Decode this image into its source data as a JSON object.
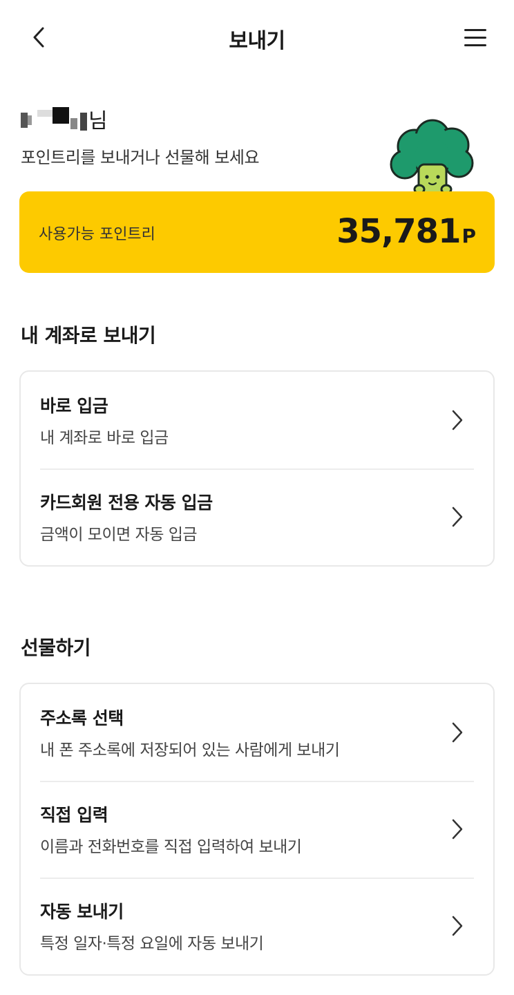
{
  "header": {
    "title": "보내기"
  },
  "greeting": {
    "name_suffix": "님",
    "subtitle": "포인트리를 보내거나 선물해 보세요"
  },
  "balance": {
    "label": "사용가능 포인트리",
    "value": "35,781",
    "unit": "P",
    "color": "#fdca00"
  },
  "section_account": {
    "title": "내 계좌로 보내기",
    "items": [
      {
        "title": "바로 입금",
        "desc": "내 계좌로 바로 입금"
      },
      {
        "title": "카드회원 전용 자동 입금",
        "desc": "금액이 모이면 자동 입금"
      }
    ]
  },
  "section_gift": {
    "title": "선물하기",
    "items": [
      {
        "title": "주소록 선택",
        "desc": "내 폰 주소록에 저장되어 있는 사람에게 보내기"
      },
      {
        "title": "직접 입력",
        "desc": "이름과 전화번호를 직접 입력하여 보내기"
      },
      {
        "title": "자동 보내기",
        "desc": "특정 일자·특정 요일에 자동 보내기"
      }
    ]
  },
  "icons": {
    "back": "chevron-left-icon",
    "menu": "hamburger-menu-icon",
    "row_arrow": "chevron-right-icon"
  }
}
